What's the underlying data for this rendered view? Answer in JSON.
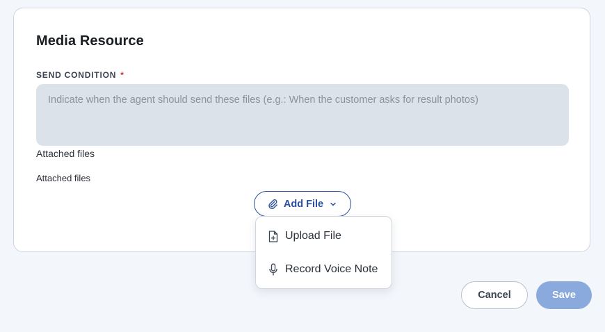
{
  "dialog": {
    "title": "Media Resource",
    "send_condition": {
      "label": "SEND CONDITION",
      "required_marker": "*",
      "placeholder": "Indicate when the agent should send these files (e.g.: When the customer asks for result photos)",
      "value": ""
    },
    "attached_files_label": "Attached files",
    "attached_files_subtitle": "Attached files",
    "add_file_button": {
      "label": "Add File",
      "icon": "paperclip-icon"
    },
    "add_file_menu": {
      "items": [
        {
          "label": "Upload File",
          "icon": "file-upload-icon"
        },
        {
          "label": "Record Voice Note",
          "icon": "microphone-icon"
        }
      ]
    }
  },
  "footer": {
    "cancel_label": "Cancel",
    "save_label": "Save"
  },
  "colors": {
    "accent": "#2a4f9c",
    "save_disabled": "#8aa9dc",
    "required": "#d23a3a",
    "input_bg": "#dbe2ea"
  }
}
